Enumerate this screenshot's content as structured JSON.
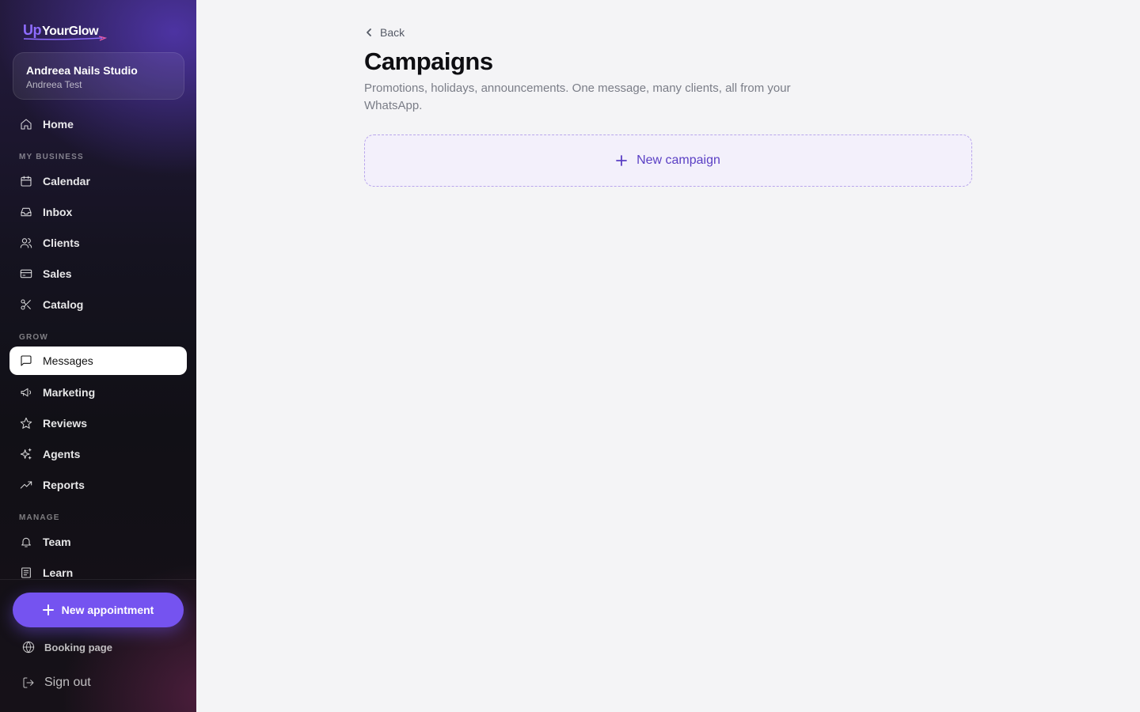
{
  "brand": {
    "logo_up": "Up",
    "logo_name": "YourGlow",
    "accent": "#7553f0"
  },
  "studio": {
    "name": "Andreea Nails Studio",
    "user": "Andreea Test"
  },
  "nav": {
    "home": {
      "label": "Home",
      "icon": "home-icon"
    },
    "sections": {
      "my_business": "MY BUSINESS",
      "grow": "GROW",
      "manage": "MANAGE"
    },
    "my_business": [
      {
        "label": "Calendar",
        "icon": "calendar-icon"
      },
      {
        "label": "Inbox",
        "icon": "inbox-icon"
      },
      {
        "label": "Clients",
        "icon": "users-icon"
      },
      {
        "label": "Sales",
        "icon": "credit-card-icon"
      },
      {
        "label": "Catalog",
        "icon": "scissors-icon"
      }
    ],
    "grow": [
      {
        "label": "Messages",
        "icon": "message-icon",
        "active": true
      },
      {
        "label": "Marketing",
        "icon": "megaphone-icon"
      },
      {
        "label": "Reviews",
        "icon": "star-icon"
      },
      {
        "label": "Agents",
        "icon": "sparkles-icon"
      },
      {
        "label": "Reports",
        "icon": "trend-icon"
      }
    ],
    "manage": [
      {
        "label": "Team",
        "icon": "bell-icon"
      },
      {
        "label": "Learn",
        "icon": "book-icon"
      }
    ]
  },
  "actions": {
    "new_appointment": "New appointment",
    "booking_page": "Booking page",
    "sign_out": "Sign out"
  },
  "main": {
    "back_label": "Back",
    "title": "Campaigns",
    "description": "Promotions, holidays, announcements. One message, many clients, all from your WhatsApp.",
    "new_campaign_label": "New campaign"
  }
}
